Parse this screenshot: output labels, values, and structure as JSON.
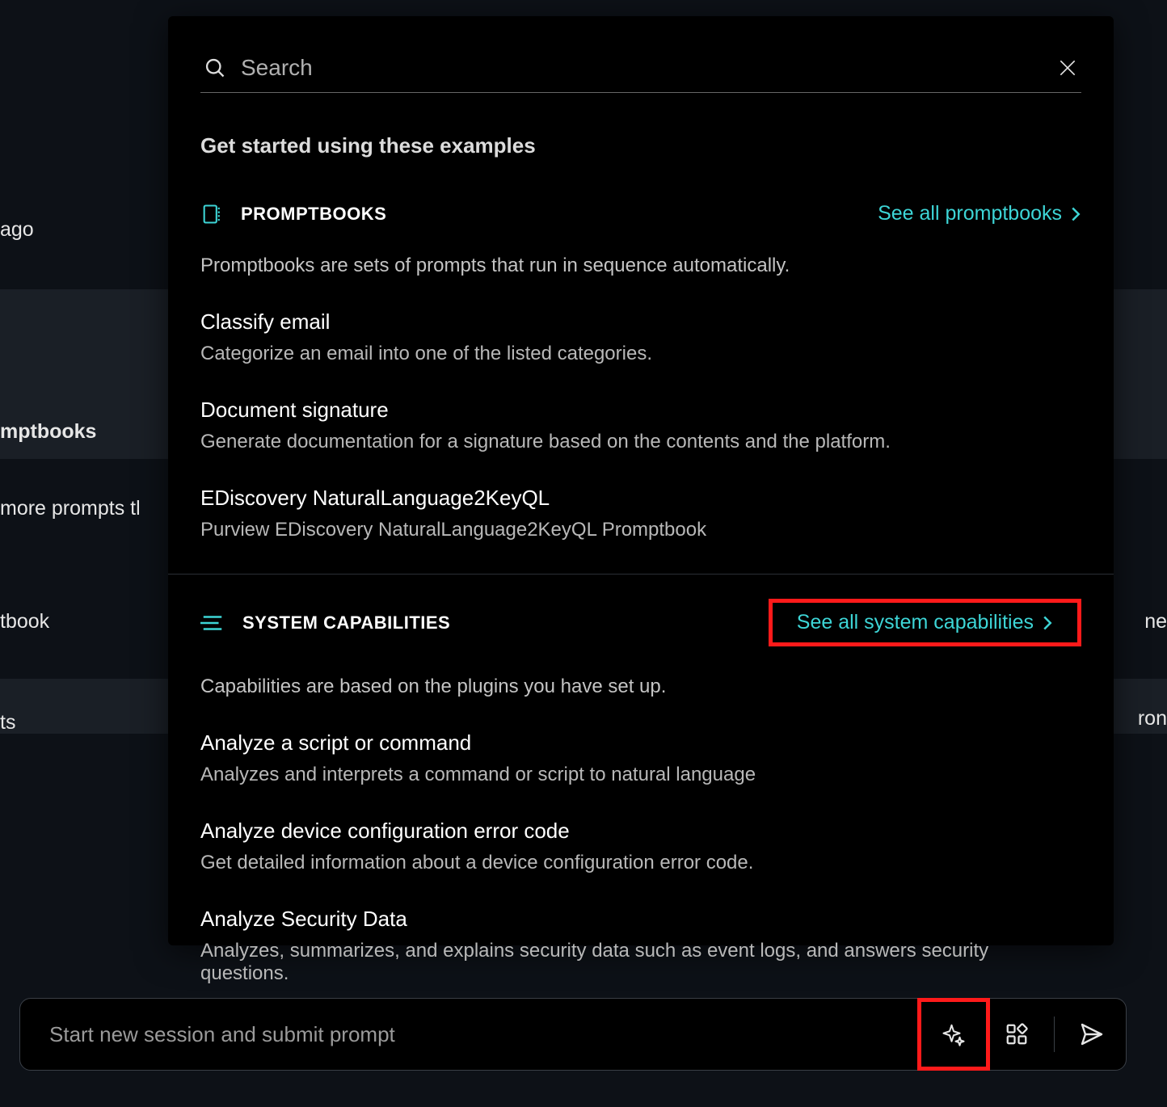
{
  "background": {
    "ago_text": "ago",
    "mptbooks": "mptbooks",
    "more_prompts": " more prompts tl",
    "tbook": "tbook",
    "ts": "ts",
    "right1": "ne",
    "right2": "ron"
  },
  "search": {
    "placeholder": "Search"
  },
  "intro_subtitle": "Get started using these examples",
  "promptbooks": {
    "title": "PROMPTBOOKS",
    "see_all": "See all promptbooks",
    "description": "Promptbooks are sets of prompts that run in sequence automatically.",
    "items": [
      {
        "title": "Classify email",
        "desc": "Categorize an email into one of the listed categories."
      },
      {
        "title": "Document signature",
        "desc": "Generate documentation for a signature based on the contents and the platform."
      },
      {
        "title": "EDiscovery NaturalLanguage2KeyQL",
        "desc": "Purview EDiscovery NaturalLanguage2KeyQL Promptbook"
      }
    ]
  },
  "capabilities": {
    "title": "SYSTEM CAPABILITIES",
    "see_all": "See all system capabilities",
    "description": "Capabilities are based on the plugins you have set up.",
    "items": [
      {
        "title": "Analyze a script or command",
        "desc": "Analyzes and interprets a command or script to natural language"
      },
      {
        "title": "Analyze device configuration error code",
        "desc": "Get detailed information about a device configuration error code."
      },
      {
        "title": "Analyze Security Data",
        "desc": "Analyzes, summarizes, and explains security data such as event logs, and answers security questions."
      }
    ]
  },
  "prompt_bar": {
    "placeholder": "Start new session and submit prompt"
  }
}
